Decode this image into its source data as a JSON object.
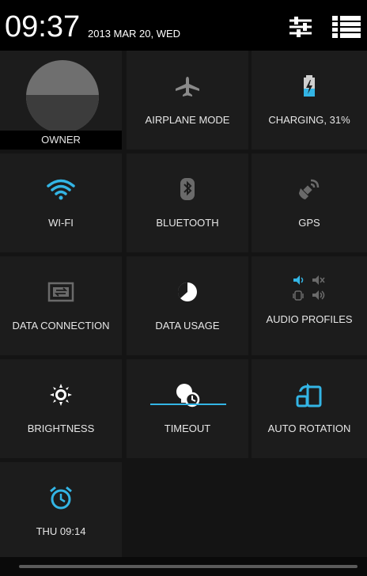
{
  "status": {
    "time": "09:37",
    "date": "2013 MAR 20, WED",
    "icons": [
      "settings-sliders-icon",
      "list-view-icon"
    ]
  },
  "owner": {
    "label": "OWNER",
    "icon": "avatar"
  },
  "tiles": [
    {
      "label": "AIRPLANE MODE",
      "icon": "airplane-icon",
      "color": "#8a8a8a"
    },
    {
      "label": "CHARGING, 31%",
      "icon": "battery-charging-icon",
      "color": "#33b5e5"
    },
    {
      "label": "WI-FI",
      "icon": "wifi-icon",
      "color": "#33b5e5"
    },
    {
      "label": "BLUETOOTH",
      "icon": "bluetooth-icon",
      "color": "#8a8a8a"
    },
    {
      "label": "GPS",
      "icon": "gps-satellite-icon",
      "color": "#8a8a8a"
    },
    {
      "label": "DATA CONNECTION",
      "icon": "data-connection-icon",
      "color": "#8a8a8a"
    },
    {
      "label": "DATA USAGE",
      "icon": "data-usage-icon",
      "color": "#ffffff"
    },
    {
      "label": "AUDIO PROFILES",
      "icon": "audio-profiles-icon",
      "color": "#33b5e5"
    },
    {
      "label": "BRIGHTNESS",
      "icon": "brightness-icon",
      "color": "#ffffff"
    },
    {
      "label": "TIMEOUT",
      "icon": "timeout-icon",
      "color": "#ffffff"
    },
    {
      "label": "AUTO ROTATION",
      "icon": "auto-rotation-icon",
      "color": "#33b5e5"
    },
    {
      "label": "THU 09:14",
      "icon": "alarm-clock-icon",
      "color": "#33b5e5"
    }
  ],
  "accent": "#33b5e5"
}
